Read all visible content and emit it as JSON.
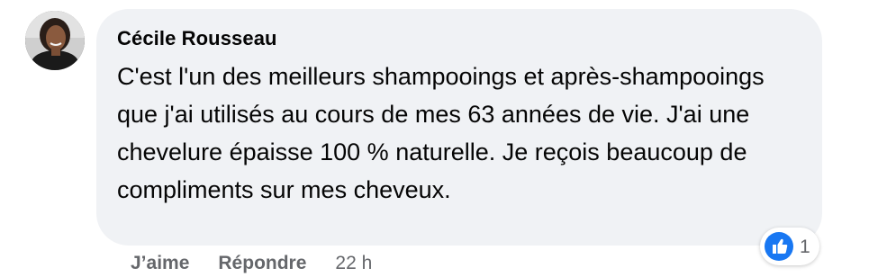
{
  "comment": {
    "author": "Cécile Rousseau",
    "text": "C'est l'un des meilleurs shampooings et après-shampooings que j'ai utilisés au cours de mes 63 années de vie. J'ai une chevelure épaisse 100 % naturelle. Je reçois beaucoup de compliments sur mes cheveux.",
    "avatar_icon": "profile-photo",
    "reaction": {
      "icon": "like-thumbs-up-icon",
      "count": "1",
      "color": "#1877f2"
    },
    "actions": {
      "like_label": "J’aime",
      "reply_label": "Répondre",
      "time": "22 h"
    }
  },
  "colors": {
    "bubble_bg": "#f0f2f5",
    "text": "#050505",
    "secondary_text": "#65676b"
  }
}
